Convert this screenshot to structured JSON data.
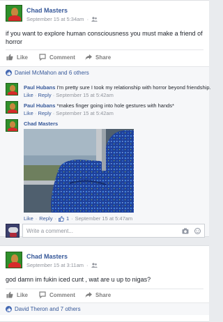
{
  "post1": {
    "author": "Chad Masters",
    "timestamp": "September 15 at 5:34am",
    "audience_icon": "friends-icon",
    "text_line1": "if you want to explore human consciousness you must make a friend of",
    "text_line2": "horror",
    "actions": {
      "like": "Like",
      "comment": "Comment",
      "share": "Share"
    },
    "likes_summary": "Daniel McMahon and 6 others",
    "comments": [
      {
        "author": "Paul Hubans",
        "text": "I'm pretty sure I took my relationship with horror beyond friendship.",
        "like": "Like",
        "reply": "Reply",
        "time": "September 15 at 5:42am"
      },
      {
        "author": "Paul Hubans",
        "text": "*makes finger going into hole gestures with hands*",
        "like": "Like",
        "reply": "Reply",
        "time": "September 15 at 5:42am"
      },
      {
        "author": "Chad Masters",
        "like": "Like",
        "reply": "Reply",
        "like_count": "1",
        "time": "September 15 at 5:47am"
      }
    ],
    "write_placeholder": "Write a comment..."
  },
  "post2": {
    "author": "Chad Masters",
    "timestamp": "September 15 at 3:11am",
    "audience_icon": "friends-icon",
    "text": "god damn im fukin iced cunt , wat are u up to nigas?",
    "actions": {
      "like": "Like",
      "comment": "Comment",
      "share": "Share"
    },
    "likes_summary": "David Theron and 7 others"
  },
  "colors": {
    "link": "#365899",
    "meta": "#90949c",
    "background": "#e9ebee",
    "facebook_blue": "#4267b2"
  }
}
